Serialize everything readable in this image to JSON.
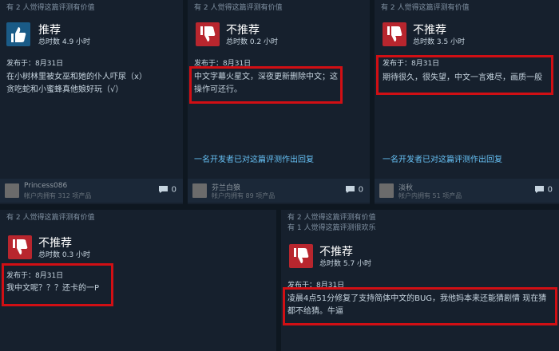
{
  "reviews": [
    {
      "helpful_lines": [
        "有 2 人觉得这篇评测有价值"
      ],
      "verdict": "推荐",
      "hours": "总时数 4.9 小时",
      "posted": "发布于：8月31日",
      "text": "在小树林里被女巫和她的仆人吓尿（x）\n贪吃蛇和小蜜蜂真他娘好玩（√）",
      "reply": "",
      "user": "Princess086",
      "products": "帐户内拥有 312 项产品",
      "comments": "0",
      "thumb": "thumbs-up"
    },
    {
      "helpful_lines": [
        "有 2 人觉得这篇评测有价值"
      ],
      "verdict": "不推荐",
      "hours": "总时数 0.2 小时",
      "posted": "发布于：8月31日",
      "text": "中文字幕火星文，深夜更新删除中文；这操作可还行。",
      "reply": "一名开发者已对这篇评测作出回复",
      "user": "芬兰白狼",
      "products": "帐户内拥有 89 项产品",
      "comments": "0",
      "thumb": "thumbs-down"
    },
    {
      "helpful_lines": [
        "有 2 人觉得这篇评测有价值"
      ],
      "verdict": "不推荐",
      "hours": "总时数 3.5 小时",
      "posted": "发布于：8月31日",
      "text": "期待很久，很失望，中文一言难尽，画质一般",
      "reply": "一名开发者已对这篇评测作出回复",
      "user": "淡秋",
      "products": "帐户内拥有 51 项产品",
      "comments": "0",
      "thumb": "thumbs-down"
    },
    {
      "helpful_lines": [
        "有 2 人觉得这篇评测有价值"
      ],
      "verdict": "不推荐",
      "hours": "总时数 0.3 小时",
      "posted": "发布于：8月31日",
      "text": "我中文呢？？？还卡的一P",
      "reply": "",
      "user": "",
      "products": "",
      "comments": "",
      "thumb": "thumbs-down"
    },
    {
      "helpful_lines": [
        "有 2 人觉得这篇评测有价值",
        "有 1 人觉得这篇评测很欢乐"
      ],
      "verdict": "不推荐",
      "hours": "总时数 5.7 小时",
      "posted": "发布于：8月31日",
      "text": "凌晨4点51分修复了支持简体中文的BUG，我他妈本来还能猜剧情 现在猜都不给猜。牛逼",
      "reply": "",
      "user": "",
      "products": "",
      "comments": "",
      "thumb": "thumbs-down"
    }
  ],
  "colors": {
    "page_bg": "#0e1720",
    "card_bg": "#16202d",
    "thumbs_up": "#1a5b87",
    "thumbs_down": "#b8262e",
    "highlight": "#d10f14",
    "link": "#66c0f4"
  }
}
